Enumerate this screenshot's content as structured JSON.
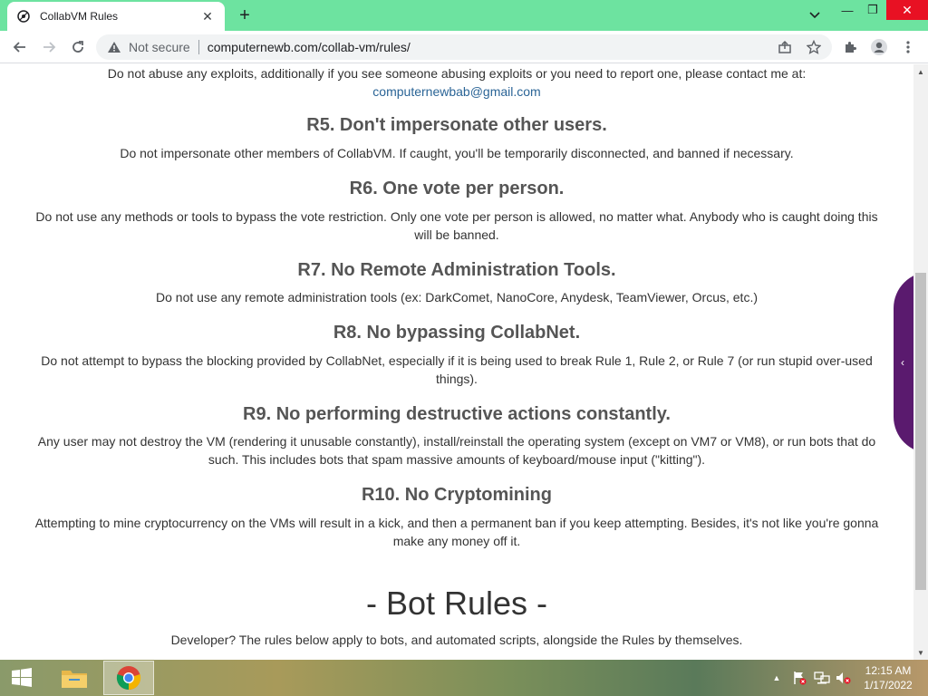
{
  "browser": {
    "tab_title": "CollabVM Rules",
    "tab_close_glyph": "✕",
    "new_tab_glyph": "+",
    "security_label": "Not secure",
    "url": "computernewb.com/collab-vm/rules/",
    "window_controls": {
      "minimize": "—",
      "maximize": "❐",
      "close": "✕"
    }
  },
  "page": {
    "intro_text": "Do not abuse any exploits, additionally if you see someone abusing exploits or you need to report one, please contact me at:",
    "contact_email": "computernewbab@gmail.com",
    "rules": [
      {
        "heading": "R5. Don't impersonate other users.",
        "text": "Do not impersonate other members of CollabVM. If caught, you'll be temporarily disconnected, and banned if necessary."
      },
      {
        "heading": "R6. One vote per person.",
        "text": "Do not use any methods or tools to bypass the vote restriction. Only one vote per person is allowed, no matter what. Anybody who is caught doing this will be banned."
      },
      {
        "heading": "R7. No Remote Administration Tools.",
        "text": "Do not use any remote administration tools (ex: DarkComet, NanoCore, Anydesk, TeamViewer, Orcus, etc.)"
      },
      {
        "heading": "R8. No bypassing CollabNet.",
        "text": "Do not attempt to bypass the blocking provided by CollabNet, especially if it is being used to break Rule 1, Rule 2, or Rule 7 (or run stupid over-used things)."
      },
      {
        "heading": "R9. No performing destructive actions constantly.",
        "text": "Any user may not destroy the VM (rendering it unusable constantly), install/reinstall the operating system (except on VM7 or VM8), or run bots that do such. This includes bots that spam massive amounts of keyboard/mouse input (\"kitting\")."
      },
      {
        "heading": "R10. No Cryptomining",
        "text": "Attempting to mine cryptocurrency on the VMs will result in a kick, and then a permanent ban if you keep attempting. Besides, it's not like you're gonna make any money off it."
      }
    ],
    "bot_rules_title": "- Bot Rules -",
    "bot_rules_intro": "Developer? The rules below apply to bots, and automated scripts, alongside the Rules by themselves.",
    "side_tab_glyph": "‹"
  },
  "taskbar": {
    "time": "12:15 AM",
    "date": "1/17/2022",
    "tray_overflow_glyph": "▲"
  },
  "icons": {
    "favicon": "collabvm-logo-icon",
    "back": "back-arrow-icon",
    "forward": "forward-arrow-icon",
    "reload": "reload-icon",
    "warning": "warning-icon",
    "share": "share-icon",
    "bookmark": "star-icon",
    "extensions": "puzzle-icon",
    "profile": "profile-icon",
    "menu": "kebab-menu-icon"
  },
  "colors": {
    "tab_strip": "#6de3a0",
    "close_button": "#e81123",
    "heading": "#555555",
    "link": "#2a6496",
    "side_tab": "#5a1a6e"
  }
}
